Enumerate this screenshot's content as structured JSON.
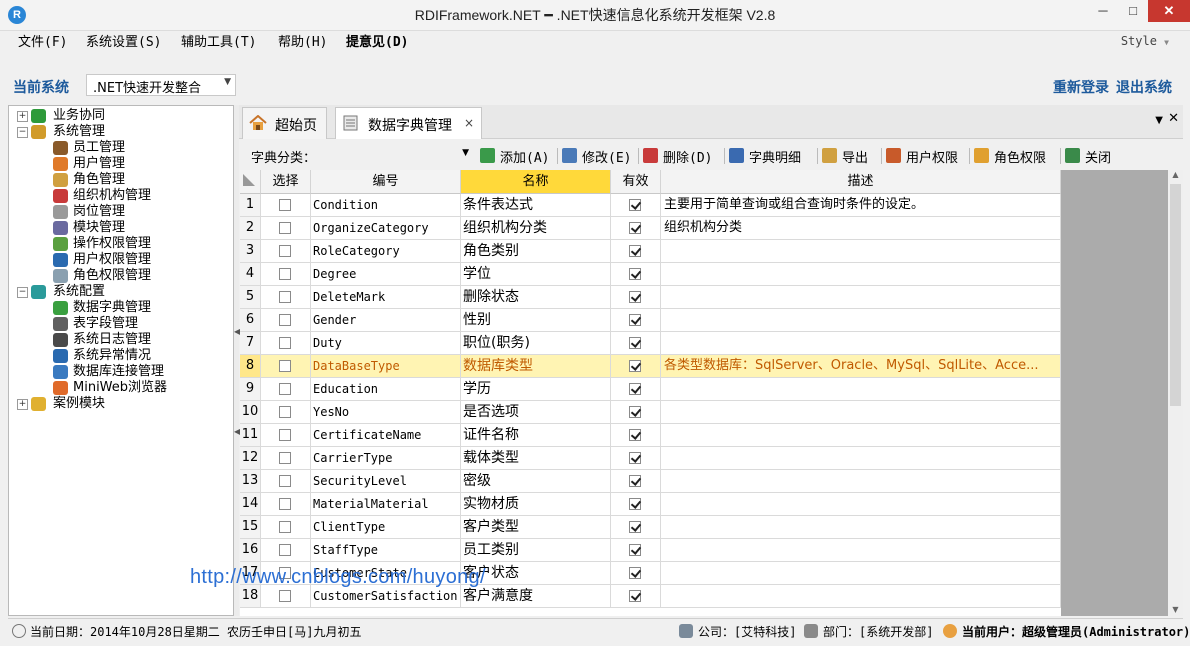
{
  "window": {
    "title": "RDIFramework.NET ━ .NET快速信息化系统开发框架 V2.8",
    "app_icon_letter": "R",
    "min": "─",
    "max": "□",
    "close": "✕"
  },
  "menu": {
    "items": [
      "文件(F)",
      "系统设置(S)",
      "辅助工具(T)",
      "帮助(H)",
      "提意见(D)"
    ],
    "style_label": "Style",
    "style_arrow": "▼"
  },
  "system": {
    "label": "当前系统",
    "selected": ".NET快速开发整合",
    "relogin": "重新登录",
    "exit": "退出系统"
  },
  "tree": {
    "nodes": [
      {
        "text": "业务协同",
        "level": 0,
        "toggle": "+",
        "color": "#2e9a3a"
      },
      {
        "text": "系统管理",
        "level": 0,
        "toggle": "−",
        "color": "#d19b2a"
      },
      {
        "text": "员工管理",
        "level": 1,
        "color": "#8a5a2a"
      },
      {
        "text": "用户管理",
        "level": 1,
        "color": "#e07a2a"
      },
      {
        "text": "角色管理",
        "level": 1,
        "color": "#d0a040"
      },
      {
        "text": "组织机构管理",
        "level": 1,
        "color": "#c83a3a"
      },
      {
        "text": "岗位管理",
        "level": 1,
        "color": "#9a9a9a"
      },
      {
        "text": "模块管理",
        "level": 1,
        "color": "#6a6aa0"
      },
      {
        "text": "操作权限管理",
        "level": 1,
        "color": "#5aa040"
      },
      {
        "text": "用户权限管理",
        "level": 1,
        "color": "#2a6ab0"
      },
      {
        "text": "角色权限管理",
        "level": 1,
        "color": "#8aa0b0"
      },
      {
        "text": "系统配置",
        "level": 0,
        "toggle": "−",
        "color": "#2a9a9a"
      },
      {
        "text": "数据字典管理",
        "level": 1,
        "color": "#3aa040"
      },
      {
        "text": "表字段管理",
        "level": 1,
        "color": "#606060"
      },
      {
        "text": "系统日志管理",
        "level": 1,
        "color": "#4a4a4a"
      },
      {
        "text": "系统异常情况",
        "level": 1,
        "color": "#2a6ab0"
      },
      {
        "text": "数据库连接管理",
        "level": 1,
        "color": "#3a7ac0"
      },
      {
        "text": "MiniWeb浏览器",
        "level": 1,
        "color": "#e06a2a"
      },
      {
        "text": "案例模块",
        "level": 0,
        "toggle": "+",
        "color": "#e0b030"
      }
    ]
  },
  "tabs": {
    "home": "超始页",
    "dict": "数据字典管理",
    "close_glyph": "×",
    "menu_glyph": "▼",
    "close_all": "✕"
  },
  "toolbar": {
    "category_label": "字典分类：",
    "combo_arrow": "▼",
    "buttons": [
      {
        "label": "添加(A)",
        "icon": "add-icon",
        "color": "#3a9a4a"
      },
      {
        "label": "修改(E)",
        "icon": "edit-icon",
        "color": "#4a7ab8"
      },
      {
        "label": "删除(D)",
        "icon": "delete-icon",
        "color": "#c83a3a"
      },
      {
        "label": "字典明细",
        "icon": "book-icon",
        "color": "#3a6ab0"
      },
      {
        "label": "导出",
        "icon": "export-icon",
        "color": "#d0a040"
      },
      {
        "label": "用户权限",
        "icon": "user-permission-icon",
        "color": "#c85a2a"
      },
      {
        "label": "角色权限",
        "icon": "role-permission-icon",
        "color": "#e0a030"
      },
      {
        "label": "关闭",
        "icon": "close-door-icon",
        "color": "#3a8a4a"
      }
    ]
  },
  "grid": {
    "columns": [
      "",
      "选择",
      "编号",
      "名称",
      "有效",
      "描述"
    ],
    "sorted_column": "名称",
    "rows": [
      {
        "n": "1",
        "code": "Condition",
        "name": "条件表达式",
        "valid": true,
        "desc": "主要用于简单查询或组合查询时条件的设定。"
      },
      {
        "n": "2",
        "code": "OrganizeCategory",
        "name": "组织机构分类",
        "valid": true,
        "desc": "组织机构分类"
      },
      {
        "n": "3",
        "code": "RoleCategory",
        "name": "角色类别",
        "valid": true,
        "desc": ""
      },
      {
        "n": "4",
        "code": "Degree",
        "name": "学位",
        "valid": true,
        "desc": ""
      },
      {
        "n": "5",
        "code": "DeleteMark",
        "name": "删除状态",
        "valid": true,
        "desc": ""
      },
      {
        "n": "6",
        "code": "Gender",
        "name": "性别",
        "valid": true,
        "desc": ""
      },
      {
        "n": "7",
        "code": "Duty",
        "name": "职位(职务)",
        "valid": true,
        "desc": ""
      },
      {
        "n": "8",
        "code": "DataBaseType",
        "name": "数据库类型",
        "valid": true,
        "desc": "各类型数据库：SqlServer、Oracle、MySql、SqlLite、Acce...",
        "selected": true
      },
      {
        "n": "9",
        "code": "Education",
        "name": "学历",
        "valid": true,
        "desc": ""
      },
      {
        "n": "10",
        "code": "YesNo",
        "name": "是否选项",
        "valid": true,
        "desc": ""
      },
      {
        "n": "11",
        "code": "CertificateName",
        "name": "证件名称",
        "valid": true,
        "desc": ""
      },
      {
        "n": "12",
        "code": "CarrierType",
        "name": "载体类型",
        "valid": true,
        "desc": ""
      },
      {
        "n": "13",
        "code": "SecurityLevel",
        "name": "密级",
        "valid": true,
        "desc": ""
      },
      {
        "n": "14",
        "code": "MaterialMaterial",
        "name": "实物材质",
        "valid": true,
        "desc": ""
      },
      {
        "n": "15",
        "code": "ClientType",
        "name": "客户类型",
        "valid": true,
        "desc": ""
      },
      {
        "n": "16",
        "code": "StaffType",
        "name": "员工类别",
        "valid": true,
        "desc": ""
      },
      {
        "n": "17",
        "code": "CustomerState",
        "name": "客户状态",
        "valid": true,
        "desc": ""
      },
      {
        "n": "18",
        "code": "CustomerSatisfaction",
        "name": "客户满意度",
        "valid": true,
        "desc": ""
      }
    ]
  },
  "watermark": "http://www.cnblogs.com/huyong/",
  "status": {
    "date": "当前日期：2014年10月28日星期二 农历壬申日[马]九月初五",
    "company": "公司：[艾特科技]",
    "department": "部门：[系统开发部]",
    "user": "当前用户：超级管理员(Administrator)"
  }
}
